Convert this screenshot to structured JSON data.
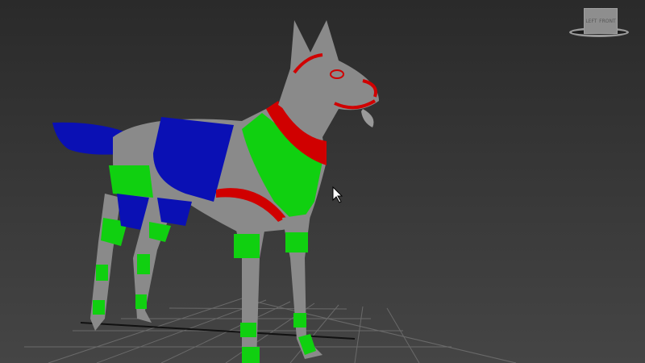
{
  "viewport": {
    "viewcube": {
      "left_label": "LEFT",
      "front_label": "FRONT"
    },
    "colors": {
      "body": "#8a8a8a",
      "blue": "#0a10b4",
      "green": "#10d010",
      "red": "#d00000",
      "grid": "#6a6a6a"
    }
  }
}
